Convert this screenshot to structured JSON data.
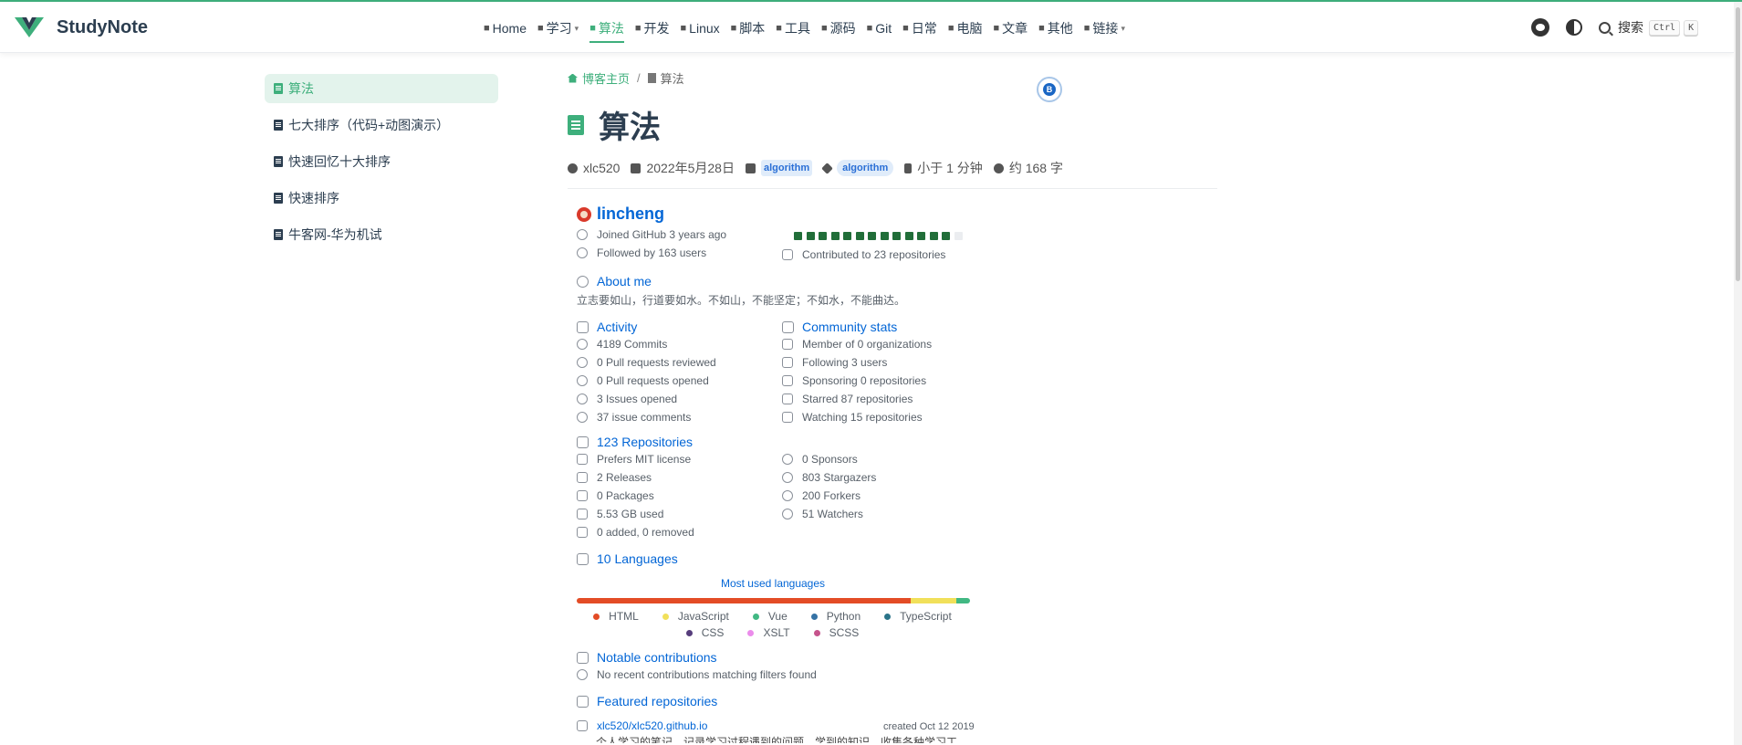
{
  "app": {
    "name": "StudyNote",
    "brand_color": "#3eaf7c"
  },
  "nav": {
    "items": [
      {
        "label": "Home",
        "icon": "home-icon",
        "caret": false,
        "active": false
      },
      {
        "label": "学习",
        "icon": "book-icon",
        "caret": true,
        "active": false
      },
      {
        "label": "算法",
        "icon": "code-icon",
        "caret": false,
        "active": true
      },
      {
        "label": "开发",
        "icon": "dev-icon",
        "caret": false,
        "active": false
      },
      {
        "label": "Linux",
        "icon": "linux-icon",
        "caret": false,
        "active": false
      },
      {
        "label": "脚本",
        "icon": "script-icon",
        "caret": false,
        "active": false
      },
      {
        "label": "工具",
        "icon": "tools-icon",
        "caret": false,
        "active": false
      },
      {
        "label": "源码",
        "icon": "source-icon",
        "caret": false,
        "active": false
      },
      {
        "label": "Git",
        "icon": "git-icon",
        "caret": false,
        "active": false
      },
      {
        "label": "日常",
        "icon": "daily-icon",
        "caret": false,
        "active": false
      },
      {
        "label": "电脑",
        "icon": "computer-icon",
        "caret": false,
        "active": false
      },
      {
        "label": "文章",
        "icon": "article-icon",
        "caret": false,
        "active": false
      },
      {
        "label": "其他",
        "icon": "other-icon",
        "caret": false,
        "active": false
      },
      {
        "label": "链接",
        "icon": "link-icon",
        "caret": true,
        "active": false
      }
    ],
    "search_label": "搜索",
    "search_key1": "Ctrl",
    "search_key2": "K"
  },
  "sidebar": {
    "items": [
      {
        "label": "算法",
        "active": true
      },
      {
        "label": "七大排序（代码+动图演示）",
        "active": false
      },
      {
        "label": "快速回忆十大排序",
        "active": false
      },
      {
        "label": "快速排序",
        "active": false
      },
      {
        "label": "牛客网-华为机试",
        "active": false
      }
    ]
  },
  "breadcrumb": {
    "home": "博客主页",
    "separator": "/",
    "current": "算法"
  },
  "page": {
    "title": "算法",
    "author": "xlc520",
    "date": "2022年5月28日",
    "category": "algorithm",
    "tag": "algorithm",
    "reading_time": "小于 1 分钟",
    "word_count": "约 168 字"
  },
  "github": {
    "name": "lincheng",
    "joined": "Joined GitHub 3 years ago",
    "followed": "Followed by 163 users",
    "contributed": "Contributed to 23 repositories",
    "contribution_bars": [
      1,
      1,
      1,
      1,
      1,
      1,
      1,
      1,
      1,
      1,
      1,
      1,
      1,
      0
    ],
    "about_title": "About me",
    "about_text": "立志要如山，行道要如水。不如山，不能坚定；不如水，不能曲达。",
    "activity": {
      "title": "Activity",
      "items": [
        "4189 Commits",
        "0 Pull requests reviewed",
        "0 Pull requests opened",
        "3 Issues opened",
        "37 issue comments"
      ]
    },
    "community": {
      "title": "Community stats",
      "items": [
        "Member of 0 organizations",
        "Following 3 users",
        "Sponsoring 0 repositories",
        "Starred 87 repositories",
        "Watching 15 repositories"
      ]
    },
    "repos": {
      "title": "123 Repositories",
      "left": [
        "Prefers MIT license",
        "2 Releases",
        "0 Packages",
        "5.53 GB used",
        "0 added, 0 removed"
      ],
      "right": [
        "0 Sponsors",
        "803 Stargazers",
        "200 Forkers",
        "51 Watchers"
      ]
    },
    "languages": {
      "title": "10 Languages",
      "chart_title": "Most used languages",
      "bar": [
        {
          "name": "HTML",
          "color": "#e34c26",
          "share": 0.85
        },
        {
          "name": "JavaScript",
          "color": "#f1e05a",
          "share": 0.115
        },
        {
          "name": "Vue",
          "color": "#41b883",
          "share": 0.035
        }
      ],
      "legend": [
        {
          "name": "HTML",
          "color": "#e34c26"
        },
        {
          "name": "JavaScript",
          "color": "#f1e05a"
        },
        {
          "name": "Vue",
          "color": "#41b883"
        },
        {
          "name": "Python",
          "color": "#3572a5"
        },
        {
          "name": "TypeScript",
          "color": "#2b7489"
        },
        {
          "name": "CSS",
          "color": "#563d7c"
        },
        {
          "name": "XSLT",
          "color": "#eb8ceb"
        },
        {
          "name": "SCSS",
          "color": "#c6538c"
        }
      ]
    },
    "notable": {
      "title": "Notable contributions",
      "text": "No recent contributions matching filters found"
    },
    "featured": {
      "title": "Featured repositories",
      "repo": "xlc520/xlc520.github.io",
      "created": "created Oct 12 2019",
      "desc": "个人学习的笔记，记录学习过程遇到的问题，学到的知识，收集各种学习工"
    }
  }
}
